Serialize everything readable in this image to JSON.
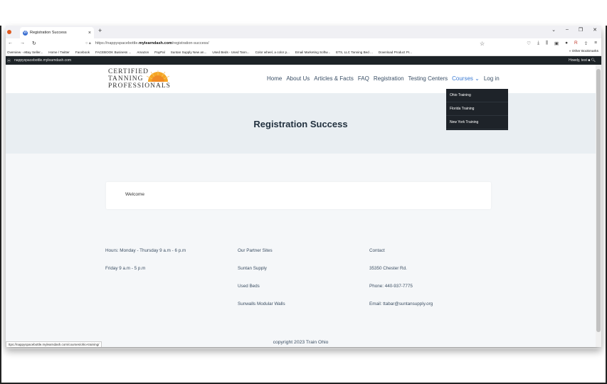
{
  "browser": {
    "tab_title": "Registration Success",
    "url_prefix": "https://nappyspacebottle.",
    "url_domain": "mylearndash.com",
    "url_path": "/registration-success/",
    "status_url": "ttps://nappyspacebottle.mylearndash.com/courses/ohio-training/"
  },
  "bookmarks": [
    "Overview - eBay Seller...",
    "Home / Twitter",
    "Facebook",
    "FACEBOOK Business ...",
    "Amazon",
    "PayPal",
    "Suntan Supply New an...",
    "Used Beds - Used Tann...",
    "Color wheel, a color p...",
    "Email Marketing Softw...",
    "ETS, LLC Tanning Bed ...",
    "Download Product Pr..."
  ],
  "bookmarks_other": "Other Bookmarks",
  "adminbar": {
    "site": "nappyspacebottle.mylearndash.com",
    "howdy": "Howdy, test"
  },
  "logo": {
    "line1": "CERTIFIED",
    "line2": "TANNING",
    "line3": "PROFESSIONALS"
  },
  "menu": {
    "home": "Home",
    "about": "About Us",
    "articles": "Articles & Facts",
    "faq": "FAQ",
    "registration": "Registration",
    "testing": "Testing Centers",
    "courses": "Courses ⌄",
    "login": "Log in"
  },
  "dropdown": [
    "Ohio Training",
    "Florida Training",
    "New York Training"
  ],
  "hero_title": "Registration Success",
  "welcome": "Welcome",
  "footer": {
    "col1": [
      "Hours: Monday - Thursday 9 a.m - 6 p.m",
      "Friday 9 a.m - 5 p.m"
    ],
    "col2": [
      "Our Partner Sites",
      "Suntan Supply",
      "Used Beds",
      "Sunwalls Modular Walls"
    ],
    "col3": [
      "Contact",
      "35350 Chester Rd.",
      "Phone: 440-937-7775",
      "Email: ttabar@suntansupply.org"
    ]
  },
  "copyright": "copyright 2023 Train Ohio"
}
